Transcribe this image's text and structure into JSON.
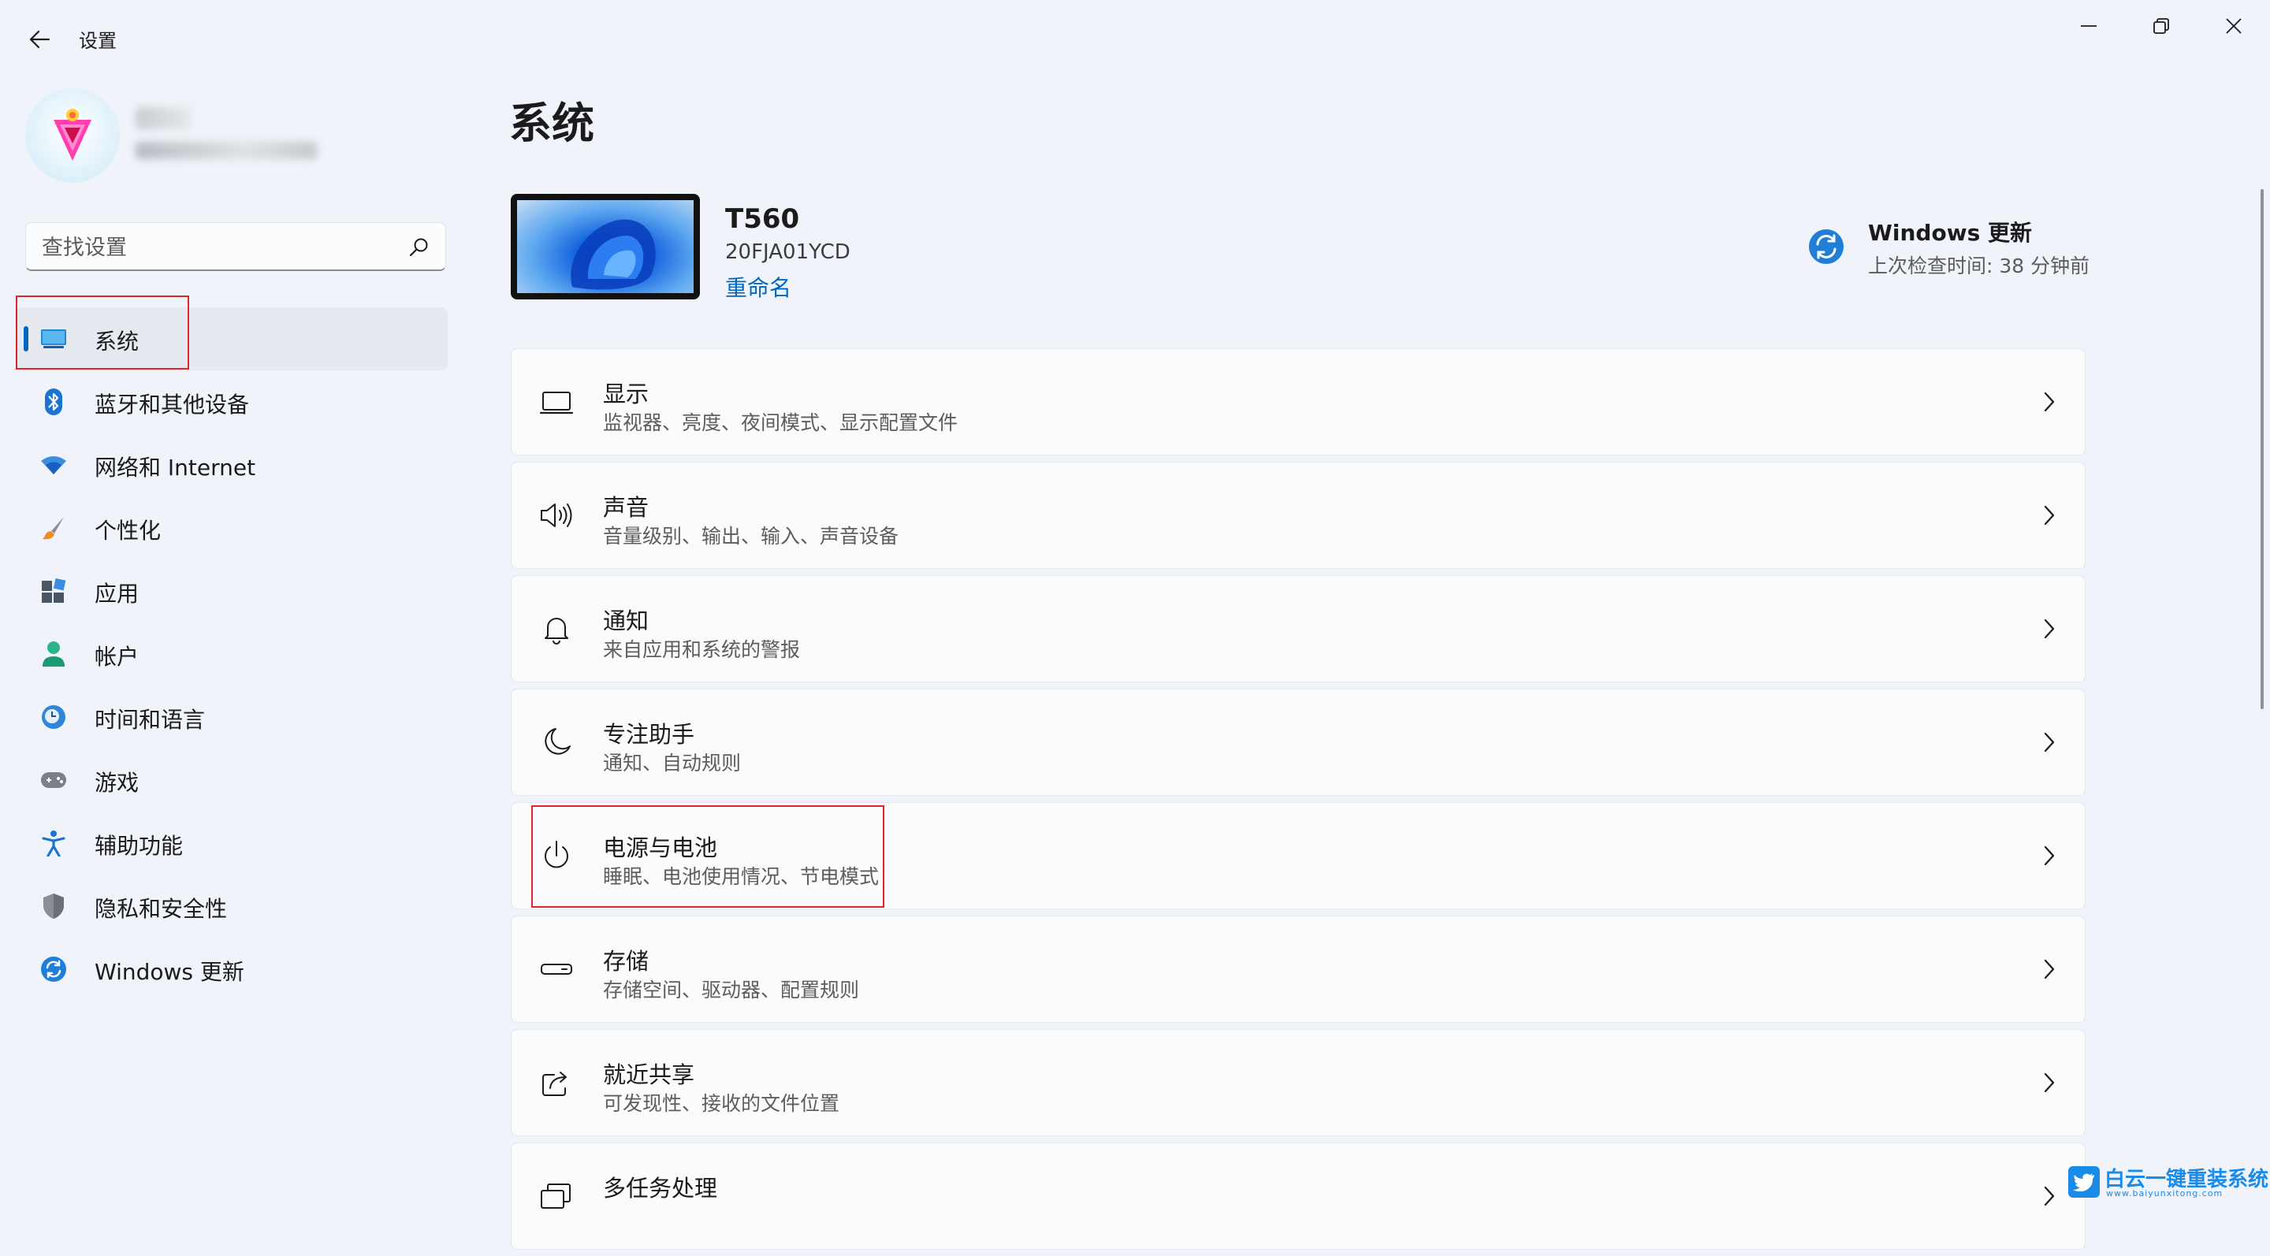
{
  "window": {
    "title": "设置",
    "back_icon": "back-arrow-icon",
    "minimize_icon": "minimize-icon",
    "maximize_icon": "restore-icon",
    "close_icon": "close-icon"
  },
  "sidebar": {
    "search": {
      "placeholder": "查找设置",
      "icon": "search-icon"
    },
    "items": [
      {
        "label": "系统",
        "icon": "display-monitor-icon",
        "selected": true
      },
      {
        "label": "蓝牙和其他设备",
        "icon": "bluetooth-icon",
        "selected": false
      },
      {
        "label": "网络和 Internet",
        "icon": "wifi-icon",
        "selected": false
      },
      {
        "label": "个性化",
        "icon": "brush-icon",
        "selected": false
      },
      {
        "label": "应用",
        "icon": "apps-icon",
        "selected": false
      },
      {
        "label": "帐户",
        "icon": "person-icon",
        "selected": false
      },
      {
        "label": "时间和语言",
        "icon": "clock-globe-icon",
        "selected": false
      },
      {
        "label": "游戏",
        "icon": "gamepad-icon",
        "selected": false
      },
      {
        "label": "辅助功能",
        "icon": "accessibility-icon",
        "selected": false
      },
      {
        "label": "隐私和安全性",
        "icon": "shield-icon",
        "selected": false
      },
      {
        "label": "Windows 更新",
        "icon": "sync-icon",
        "selected": false
      }
    ]
  },
  "main": {
    "page_title": "系统",
    "device": {
      "name": "T560",
      "model": "20FJA01YCD",
      "rename_label": "重命名"
    },
    "windows_update": {
      "title": "Windows 更新",
      "subtitle": "上次检查时间: 38 分钟前",
      "icon": "sync-icon"
    },
    "cards": [
      {
        "title": "显示",
        "subtitle": "监视器、亮度、夜间模式、显示配置文件",
        "icon": "laptop-icon"
      },
      {
        "title": "声音",
        "subtitle": "音量级别、输出、输入、声音设备",
        "icon": "speaker-icon"
      },
      {
        "title": "通知",
        "subtitle": "来自应用和系统的警报",
        "icon": "bell-icon"
      },
      {
        "title": "专注助手",
        "subtitle": "通知、自动规则",
        "icon": "moon-icon"
      },
      {
        "title": "电源与电池",
        "subtitle": "睡眠、电池使用情况、节电模式",
        "icon": "power-icon"
      },
      {
        "title": "存储",
        "subtitle": "存储空间、驱动器、配置规则",
        "icon": "storage-drive-icon"
      },
      {
        "title": "就近共享",
        "subtitle": "可发现性、接收的文件位置",
        "icon": "share-icon"
      },
      {
        "title": "多任务处理",
        "subtitle": "",
        "icon": "multitask-icon"
      }
    ]
  },
  "watermark": {
    "title": "白云一键重装系统",
    "url": "www.baiyunxitong.com"
  },
  "colors": {
    "accent": "#0067c0",
    "highlight": "#e0262a",
    "background": "#f0f3f9"
  }
}
